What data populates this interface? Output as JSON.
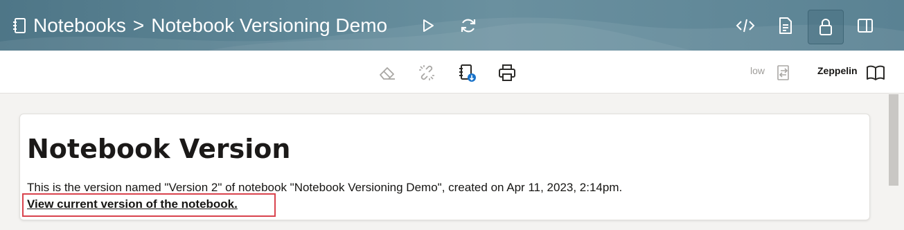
{
  "header": {
    "breadcrumb_root": "Notebooks",
    "breadcrumb_separator": ">",
    "breadcrumb_current": "Notebook Versioning Demo",
    "icons": [
      "notebook-icon",
      "run-icon",
      "refresh-icon",
      "code-icon",
      "document-icon",
      "lock-icon",
      "split-panel-icon"
    ]
  },
  "toolbar": {
    "icons": [
      "eraser-icon",
      "unlink-icon",
      "notebook-download-icon",
      "print-icon",
      "switch-icon",
      "book-icon"
    ],
    "resource_level": "low",
    "interpreter": "Zeppelin"
  },
  "content": {
    "heading": "Notebook Version",
    "description": "This is the version named \"Version 2\" of notebook \"Notebook Versioning Demo\", created on Apr 11, 2023, 2:14pm.",
    "link_text": "View current version of the notebook."
  },
  "colors": {
    "header_bg": "#5f8797",
    "highlight": "#d9434d",
    "download_badge": "#1a73c9"
  }
}
